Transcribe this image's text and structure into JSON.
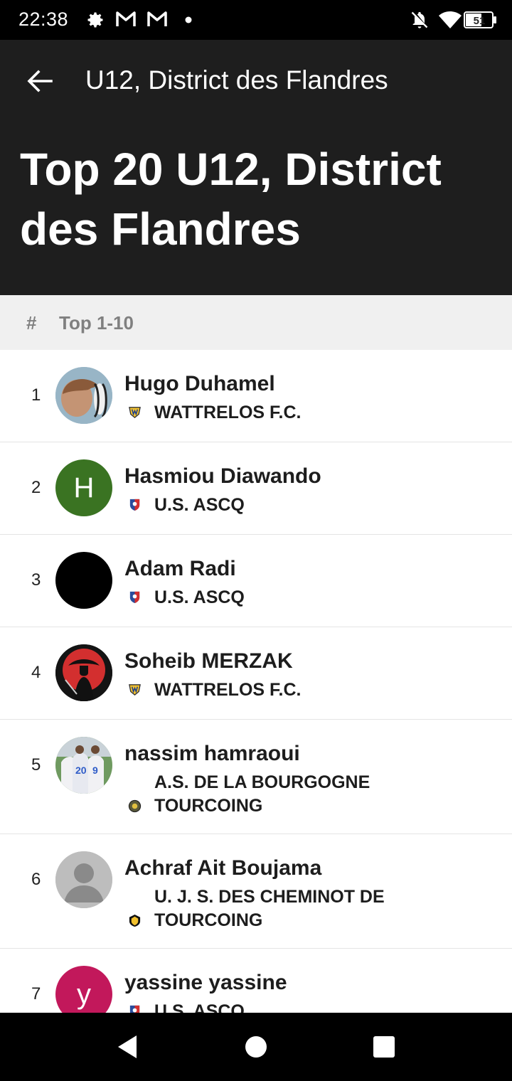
{
  "status_bar": {
    "time": "22:38",
    "battery": "51"
  },
  "appbar": {
    "title": "U12, District des Flandres"
  },
  "page": {
    "title": "Top 20 U12, District des Flandres"
  },
  "section": {
    "hash": "#",
    "label": "Top 1-10"
  },
  "players": [
    {
      "rank": "1",
      "name": "Hugo Duhamel",
      "club": "WATTRELOS F.C.",
      "avatar_type": "photo",
      "club_badge": "wattrelos-badge-icon"
    },
    {
      "rank": "2",
      "name": "Hasmiou Diawando",
      "club": "U.S. ASCQ",
      "avatar_type": "initial",
      "initial": "H",
      "avatar_color": "#3a7322",
      "club_badge": "ascq-badge-icon"
    },
    {
      "rank": "3",
      "name": "Adam Radi",
      "club": "U.S. ASCQ",
      "avatar_type": "photo",
      "avatar_color": "#000000",
      "club_badge": "ascq-badge-icon"
    },
    {
      "rank": "4",
      "name": "Soheib MERZAK",
      "club": "WATTRELOS F.C.",
      "avatar_type": "photo",
      "club_badge": "wattrelos-badge-icon"
    },
    {
      "rank": "5",
      "name": "nassim hamraoui",
      "club": "A.S. DE LA BOURGOGNE TOURCOING",
      "avatar_type": "photo",
      "club_badge": "bourgogne-badge-icon"
    },
    {
      "rank": "6",
      "name": "Achraf Ait Boujama",
      "club": "U. J. S. DES CHEMINOT DE TOURCOING",
      "avatar_type": "placeholder",
      "club_badge": "ujs-cheminot-badge-icon"
    },
    {
      "rank": "7",
      "name": "yassine yassine",
      "club": "U.S. ASCQ",
      "avatar_type": "initial",
      "initial": "y",
      "avatar_color": "#c2185b",
      "club_badge": "ascq-badge-icon"
    }
  ],
  "colors": {
    "header": "#1e1e1e",
    "section_bg": "#f0f0f0",
    "status_bar": "#000000"
  }
}
